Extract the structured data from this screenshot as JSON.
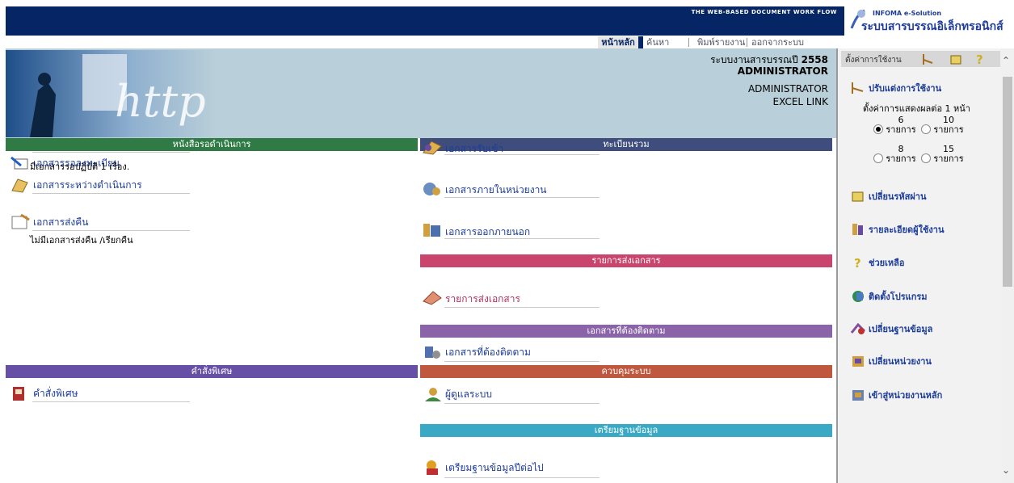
{
  "top": {
    "tagline": "THE WEB-BASED DOCUMENT WORK FLOW",
    "brand_small": "INFOMA e-Solution",
    "brand_large": "ระบบสารบรรณอิเล็กทรอนิกส์"
  },
  "menu": {
    "home": "หน้าหลัก",
    "search": "ค้นหา",
    "print": "พิมพ์รายงาน",
    "logout": "ออกจากระบบ"
  },
  "header": {
    "system_prefix": "ระบบงานสารบรรณปี ",
    "year": "2558",
    "admin_bold": "ADMINISTRATOR",
    "admin": "ADMINISTRATOR",
    "excel": "EXCEL LINK"
  },
  "sections": {
    "pending": "หนังสือรอดำเนินการ",
    "register": "ทะเบียนรวม",
    "send_list": "รายการส่งเอกสาร",
    "follow": "เอกสารที่ต้องติดตาม",
    "special": "คำสั่งพิเศษ",
    "control": "ควบคุมระบบ",
    "prepare": "เตรียมฐานข้อมูล"
  },
  "items": {
    "awaiting_register": "เอกสารรอลงทะเบียน",
    "awaiting_note": "มีเอกสารรอปฏิบัติ 1 เรื่อง.",
    "in_progress": "เอกสารระหว่างดำเนินการ",
    "returned": "เอกสารส่งคืน",
    "returned_note": "ไม่มีเอกสารส่งคืน /เรียกคืน",
    "received": "เอกสารรับเข้า",
    "internal": "เอกสารภายในหน่วยงาน",
    "external": "เอกสารออกภายนอก",
    "send_list": "รายการส่งเอกสาร",
    "follow": "เอกสารที่ต้องติดตาม",
    "special": "คำสั่งพิเศษ",
    "admin": "ผู้ดูแลระบบ",
    "prepare_next": "เตรียมฐานข้อมูลปีต่อไป"
  },
  "panel": {
    "tab_title": "ตั้งค่าการใช้งาน",
    "customize": "ปรับแต่งการใช้งาน",
    "display_setting": "ตั้งค่าการแสดงผลต่อ 1 หน้า",
    "options": [
      {
        "num": "6",
        "unit": "รายการ",
        "selected": true
      },
      {
        "num": "10",
        "unit": "รายการ",
        "selected": false
      },
      {
        "num": "8",
        "unit": "รายการ",
        "selected": false
      },
      {
        "num": "15",
        "unit": "รายการ",
        "selected": false
      }
    ],
    "change_password": "เปลี่ยนรหัสผ่าน",
    "user_details": "รายละเอียดผู้ใช้งาน",
    "help": "ช่วยเหลือ",
    "install": "ติดตั้งโปรแกรม",
    "change_db": "เปลี่ยนฐานข้อมูล",
    "change_unit": "เปลี่ยนหน่วยงาน",
    "main_unit": "เข้าสู่หน่วยงานหลัก"
  },
  "colors": {
    "navy": "#052564",
    "green": "#2f7a45",
    "slate": "#3f4d7c",
    "pink": "#c9456e",
    "purple": "#8a63a8",
    "violet": "#6650a6",
    "terracotta": "#c0573f",
    "teal": "#3aa9c3"
  }
}
